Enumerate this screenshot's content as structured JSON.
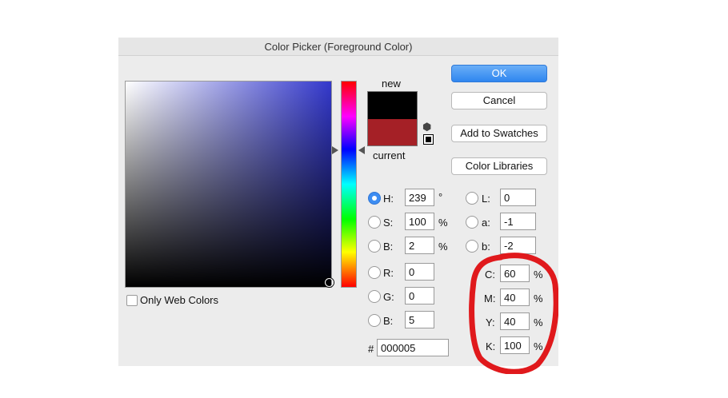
{
  "dialog": {
    "title": "Color Picker (Foreground Color)"
  },
  "preview": {
    "new_label": "new",
    "current_label": "current",
    "new_color": "#000000",
    "current_color": "#a52026"
  },
  "buttons": {
    "ok": "OK",
    "cancel": "Cancel",
    "add_to_swatches": "Add to Swatches",
    "color_libraries": "Color Libraries"
  },
  "hsb": {
    "h_label": "H:",
    "h_value": "239",
    "h_unit": "°",
    "s_label": "S:",
    "s_value": "100",
    "s_unit": "%",
    "b_label": "B:",
    "b_value": "2",
    "b_unit": "%"
  },
  "rgb": {
    "r_label": "R:",
    "r_value": "0",
    "g_label": "G:",
    "g_value": "0",
    "b_label": "B:",
    "b_value": "5"
  },
  "lab": {
    "l_label": "L:",
    "l_value": "0",
    "a_label": "a:",
    "a_value": "-1",
    "b_label": "b:",
    "b_value": "-2"
  },
  "cmyk": {
    "c_label": "C:",
    "c_value": "60",
    "c_unit": "%",
    "m_label": "M:",
    "m_value": "40",
    "m_unit": "%",
    "y_label": "Y:",
    "y_value": "40",
    "y_unit": "%",
    "k_label": "K:",
    "k_value": "100",
    "k_unit": "%"
  },
  "hex": {
    "label": "#",
    "value": "000005"
  },
  "only_web_colors": {
    "label": "Only Web Colors",
    "checked": false
  },
  "colors": {
    "ok_button": "#2f86ef",
    "annotation": "#e0191c"
  }
}
